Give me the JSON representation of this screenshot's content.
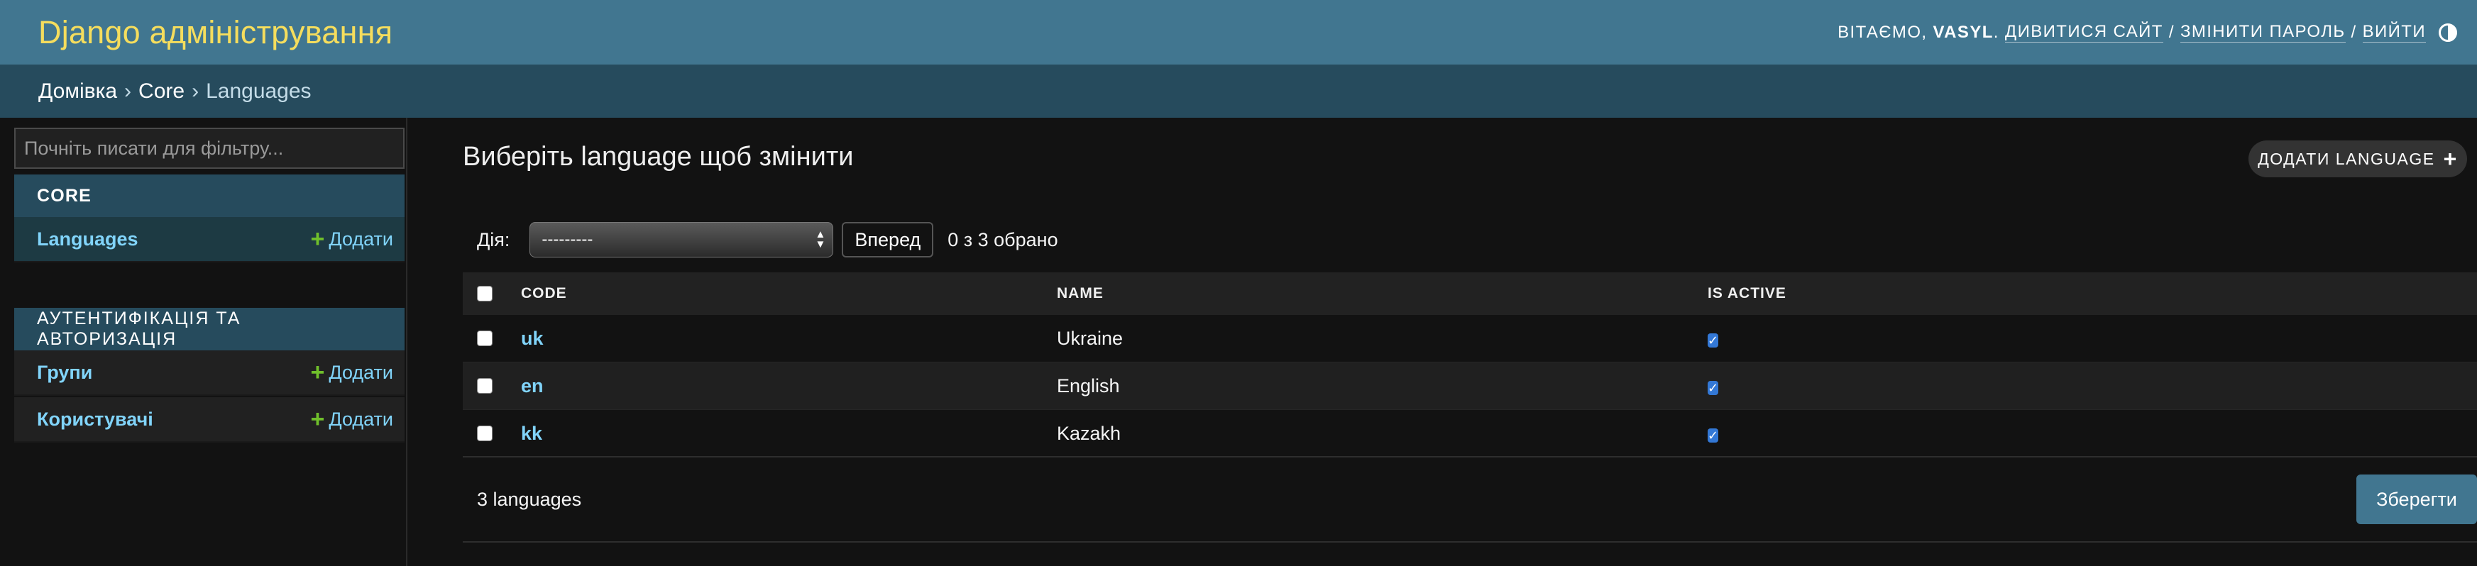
{
  "header": {
    "brand": "Django адміністрування",
    "welcome": "Вітаємо,",
    "username": "VASYL",
    "view_site": "Дивитися сайт",
    "change_password": "Змінити пароль",
    "logout": "Вийти",
    "separator": "/"
  },
  "breadcrumbs": {
    "home": "Домівка",
    "app": "Core",
    "model": "Languages",
    "arrow": "›"
  },
  "sidebar": {
    "filter_placeholder": "Почніть писати для фільтру...",
    "apps": [
      {
        "caption": "Core",
        "models": [
          {
            "label": "Languages",
            "add": "Додати"
          }
        ]
      },
      {
        "caption": "Аутентифікація та авторизація",
        "models": [
          {
            "label": "Групи",
            "add": "Додати"
          },
          {
            "label": "Користувачі",
            "add": "Додати"
          }
        ]
      }
    ]
  },
  "main": {
    "title": "Виберіть language щоб змінити",
    "add_button": "Додати Language",
    "actions": {
      "label": "Дія:",
      "selected": "---------",
      "go": "Вперед",
      "counter": "0 з 3 обрано"
    },
    "columns": [
      "Code",
      "Name",
      "Is active"
    ],
    "rows": [
      {
        "code": "uk",
        "name": "Ukraine",
        "is_active": true
      },
      {
        "code": "en",
        "name": "English",
        "is_active": true
      },
      {
        "code": "kk",
        "name": "Kazakh",
        "is_active": true
      }
    ],
    "result_count": "3 languages",
    "save": "Зберегти"
  },
  "colors": {
    "header_bg": "#417690",
    "breadcrumbs_bg": "#264b5d",
    "brand": "#f5dd5d",
    "link": "#81d4fa",
    "add_plus": "#70bf2b",
    "checkbox": "#3378d6"
  }
}
